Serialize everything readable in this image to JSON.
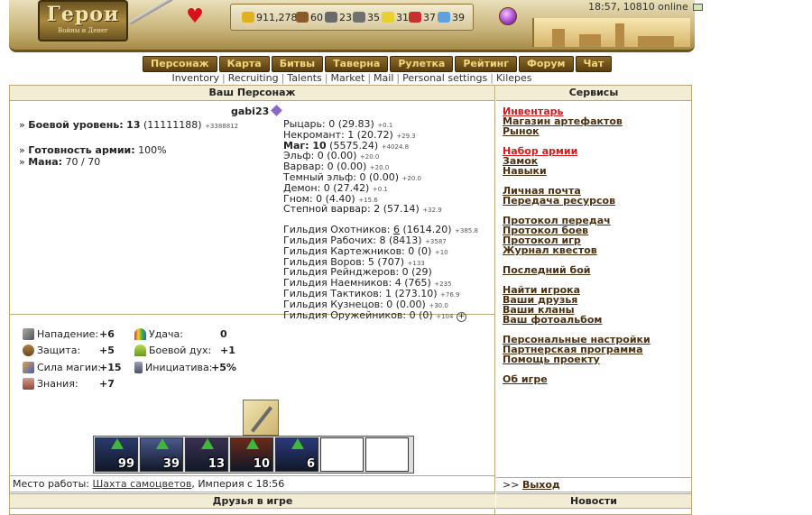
{
  "header": {
    "logo_title": "Герои",
    "logo_subtitle": "Войны и Денег",
    "resources": [
      {
        "icon": "gold-icon",
        "value": "911,278",
        "color": "#e0b020"
      },
      {
        "icon": "wood-icon",
        "value": "60",
        "color": "#8a5a2a"
      },
      {
        "icon": "ore-icon",
        "value": "23",
        "color": "#6a6a6a"
      },
      {
        "icon": "mercury-icon",
        "value": "35",
        "color": "#707070"
      },
      {
        "icon": "sulfur-icon",
        "value": "31",
        "color": "#e8d030"
      },
      {
        "icon": "crystal-icon",
        "value": "37",
        "color": "#c83030"
      },
      {
        "icon": "gems-icon",
        "value": "39",
        "color": "#60a0e0"
      }
    ],
    "time_online": "18:57, 10810 online"
  },
  "main_nav": [
    "Персонаж",
    "Карта",
    "Битвы",
    "Таверна",
    "Рулетка",
    "Рейтинг",
    "Форум",
    "Чат"
  ],
  "sub_nav": [
    "Inventory",
    "Recruiting",
    "Talents",
    "Market",
    "Mail",
    "Personal settings",
    "Kilepes"
  ],
  "character": {
    "header": "Ваш Персонаж",
    "nickname": "gabi23",
    "level_label": "Боевой уровень:",
    "level_value": "13",
    "level_exp": "(11111188)",
    "level_delta": "+3388812",
    "army_ready_label": "Готовность армии:",
    "army_ready_value": "100%",
    "mana_label": "Мана:",
    "mana_value": "70 / 70",
    "factions": [
      {
        "label": "Рыцарь: 0 (29.83)",
        "delta": "+0.1",
        "bold": false
      },
      {
        "label": "Некромант: 1 (20.72)",
        "delta": "+29.3",
        "bold": false
      },
      {
        "label": "Маг: 10",
        "extra": " (5575.24)",
        "delta": "+4024.8",
        "bold": true
      },
      {
        "label": "Эльф: 0 (0.00)",
        "delta": "+20.0",
        "bold": false
      },
      {
        "label": "Варвар: 0 (0.00)",
        "delta": "+20.0",
        "bold": false
      },
      {
        "label": "Темный эльф: 0 (0.00)",
        "delta": "+20.0",
        "bold": false
      },
      {
        "label": "Демон: 0 (27.42)",
        "delta": "+0.1",
        "bold": false
      },
      {
        "label": "Гном: 0 (4.40)",
        "delta": "+15.6",
        "bold": false
      },
      {
        "label": "Степной варвар: 2 (57.14)",
        "delta": "+32.9",
        "bold": false
      }
    ],
    "guilds": [
      {
        "label": "Гильдия Охотников: ",
        "level": "6",
        "rest": " (1614.20)",
        "delta": "+385.8"
      },
      {
        "label": "Гильдия Рабочих: 8 (8413)",
        "level": "",
        "rest": "",
        "delta": "+3587"
      },
      {
        "label": "Гильдия Картежников: 0 (0)",
        "level": "",
        "rest": "",
        "delta": "+10"
      },
      {
        "label": "Гильдия Воров: 5 (707)",
        "level": "",
        "rest": "",
        "delta": "+133"
      },
      {
        "label": "Гильдия Рейнджеров: 0 (29)",
        "level": "",
        "rest": "",
        "delta": ""
      },
      {
        "label": "Гильдия Наемников: 4 (765)",
        "level": "",
        "rest": "",
        "delta": "+235"
      },
      {
        "label": "Гильдия Тактиков: 1 (273.10)",
        "level": "",
        "rest": "",
        "delta": "+76.9"
      },
      {
        "label": "Гильдия Кузнецов: 0 (0.00)",
        "level": "",
        "rest": "",
        "delta": "+30.0"
      },
      {
        "label": "Гильдия Оружейников: 0 (0)",
        "level": "",
        "rest": "",
        "delta": "+104"
      }
    ]
  },
  "attributes": {
    "attack_label": "Нападение:",
    "attack_value": "+6",
    "defense_label": "Защита:",
    "defense_value": "+5",
    "spellpower_label": "Сила магии:",
    "spellpower_value": "+15",
    "knowledge_label": "Знания:",
    "knowledge_value": "+7",
    "luck_label": "Удача:",
    "luck_value": "0",
    "morale_label": "Боевой дух:",
    "morale_value": "+1",
    "initiative_label": "Инициатива:",
    "initiative_value": "+5%"
  },
  "army": {
    "slots": [
      "99",
      "39",
      "13",
      "10",
      "6",
      "",
      ""
    ]
  },
  "work": {
    "prefix": "Место работы: ",
    "place": "Шахта самоцветов",
    "suffix": ", Империя с 18:56"
  },
  "friends_header": "Друзья в игре",
  "services": {
    "header": "Сервисы",
    "groups": [
      [
        {
          "label": "Инвентарь",
          "red": true
        },
        {
          "label": "Магазин артефактов"
        },
        {
          "label": "Рынок"
        }
      ],
      [
        {
          "label": "Набор армии",
          "red": true
        },
        {
          "label": "Замок"
        },
        {
          "label": "Навыки"
        }
      ],
      [
        {
          "label": "Личная почта"
        },
        {
          "label": "Передача ресурсов"
        }
      ],
      [
        {
          "label": "Протокол передач"
        },
        {
          "label": "Протокол боев"
        },
        {
          "label": "Протокол игр"
        },
        {
          "label": "Журнал квестов"
        }
      ],
      [
        {
          "label": "Последний бой"
        }
      ],
      [
        {
          "label": "Найти игрока"
        },
        {
          "label": "Ваши друзья"
        },
        {
          "label": "Ваши кланы"
        },
        {
          "label": "Ваш фотоальбом"
        }
      ],
      [
        {
          "label": "Персональные настройки"
        },
        {
          "label": "Партнерская программа"
        },
        {
          "label": "Помощь проекту"
        }
      ],
      [
        {
          "label": "Об игре"
        }
      ]
    ],
    "exit_prefix": ">> ",
    "exit_label": "Выход"
  },
  "news_header": "Новости",
  "colors": {
    "accent": "#d41b1b",
    "link": "#4a3010",
    "header_bg": "#f3ecd4",
    "border": "#b9a878"
  }
}
